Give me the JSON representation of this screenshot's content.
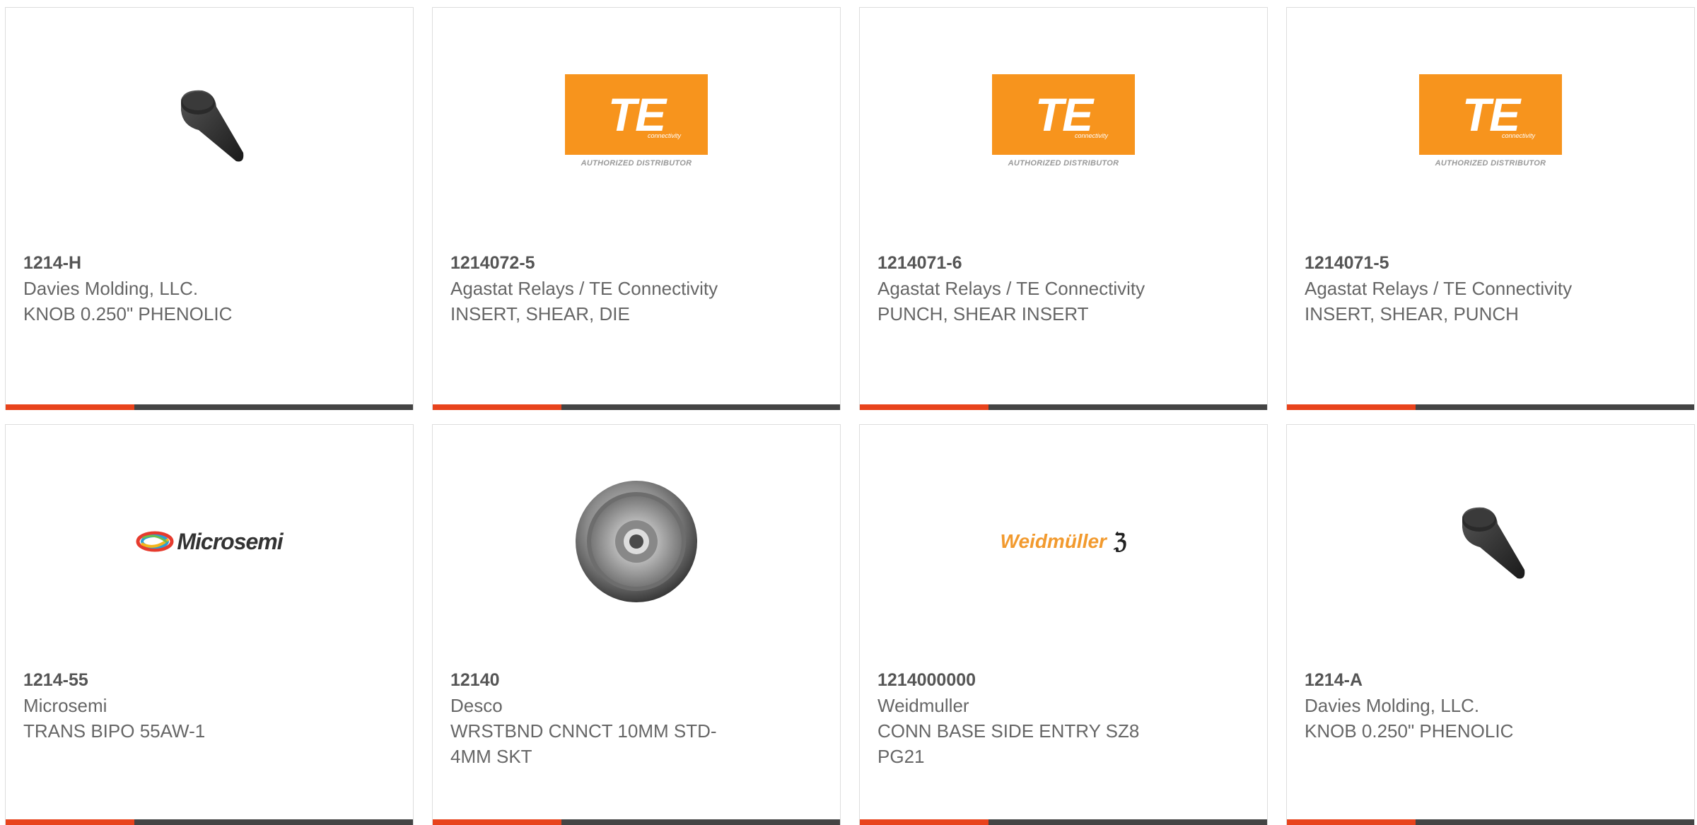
{
  "products": [
    {
      "part_number": "1214-H",
      "manufacturer": "Davies Molding, LLC.",
      "description_lines": [
        "KNOB 0.250\" PHENOLIC"
      ],
      "image": "knob-photo"
    },
    {
      "part_number": "1214072-5",
      "manufacturer": "Agastat Relays / TE Connectivity",
      "description_lines": [
        "INSERT, SHEAR, DIE"
      ],
      "image": "te-logo",
      "logo_text": "TE",
      "logo_sub": "connectivity",
      "logo_caption": "AUTHORIZED DISTRIBUTOR"
    },
    {
      "part_number": "1214071-6",
      "manufacturer": "Agastat Relays / TE Connectivity",
      "description_lines": [
        "PUNCH, SHEAR INSERT"
      ],
      "image": "te-logo",
      "logo_text": "TE",
      "logo_sub": "connectivity",
      "logo_caption": "AUTHORIZED DISTRIBUTOR"
    },
    {
      "part_number": "1214071-5",
      "manufacturer": "Agastat Relays / TE Connectivity",
      "description_lines": [
        "INSERT, SHEAR, PUNCH"
      ],
      "image": "te-logo",
      "logo_text": "TE",
      "logo_sub": "connectivity",
      "logo_caption": "AUTHORIZED DISTRIBUTOR"
    },
    {
      "part_number": "1214-55",
      "manufacturer": "Microsemi",
      "description_lines": [
        "TRANS BIPO 55AW-1"
      ],
      "image": "microsemi-logo",
      "logo_text": "Microsemi"
    },
    {
      "part_number": "12140",
      "manufacturer": "Desco",
      "description_lines": [
        "WRSTBND CNNCT 10MM STD-",
        "4MM SKT"
      ],
      "image": "snap-photo"
    },
    {
      "part_number": "1214000000",
      "manufacturer": "Weidmuller",
      "description_lines": [
        "CONN BASE SIDE ENTRY SZ8",
        "PG21"
      ],
      "image": "weidmuller-logo",
      "logo_text": "Weidmüller"
    },
    {
      "part_number": "1214-A",
      "manufacturer": "Davies Molding, LLC.",
      "description_lines": [
        "KNOB 0.250\" PHENOLIC"
      ],
      "image": "knob-photo"
    }
  ],
  "colors": {
    "accent": "#e8431c",
    "bar": "#444444",
    "te_orange": "#f7941d",
    "weidmuller_orange": "#f29a2e"
  }
}
